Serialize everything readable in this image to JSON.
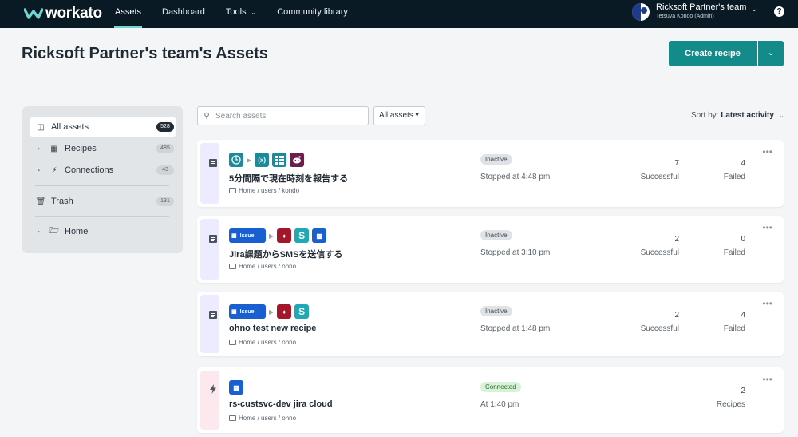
{
  "nav": {
    "logo_text": "workato",
    "items": [
      {
        "label": "Assets"
      },
      {
        "label": "Dashboard"
      },
      {
        "label": "Tools"
      },
      {
        "label": "Community library"
      }
    ],
    "team_name": "Ricksoft Partner's team",
    "team_user": "Tetsuya Kondo (Admin)",
    "help": "?"
  },
  "header": {
    "title": "Ricksoft Partner's team's Assets",
    "create_label": "Create recipe"
  },
  "sidebar": {
    "items": [
      {
        "label": "All assets",
        "count": "528"
      },
      {
        "label": "Recipes",
        "count": "485"
      },
      {
        "label": "Connections",
        "count": "43"
      },
      {
        "label": "Trash",
        "count": "131"
      },
      {
        "label": "Home"
      }
    ]
  },
  "toolbar": {
    "search_placeholder": "Search assets",
    "filter_label": "All assets",
    "sort_prefix": "Sort by:",
    "sort_value": "Latest activity"
  },
  "cards": [
    {
      "title": "5分間隔で現在時刻を報告する",
      "path": "Home / users / kondo",
      "badge": "Inactive",
      "status": "Stopped at 4:48 pm",
      "stat1_value": "7",
      "stat1_label": "Successful",
      "stat2_value": "4",
      "stat2_label": "Failed"
    },
    {
      "title": "Jira課題からSMSを送信する",
      "path": "Home / users / ohno",
      "badge": "Inactive",
      "status": "Stopped at 3:10 pm",
      "app_label": "Issue",
      "stat1_value": "2",
      "stat1_label": "Successful",
      "stat2_value": "0",
      "stat2_label": "Failed"
    },
    {
      "title": "ohno test new recipe",
      "path": "Home / users / ohno",
      "badge": "Inactive",
      "status": "Stopped at 1:48 pm",
      "app_label": "Issue",
      "stat1_value": "2",
      "stat1_label": "Successful",
      "stat2_value": "4",
      "stat2_label": "Failed"
    },
    {
      "title": "rs-custsvc-dev jira cloud",
      "path": "Home / users / ohno",
      "badge": "Connected",
      "status": "At 1:40 pm",
      "stat2_value": "2",
      "stat2_label": "Recipes"
    }
  ],
  "icons": {
    "recipe": "recipe-doc-icon",
    "connection": "lightning-icon",
    "clock": "clock-icon",
    "variable": "variable-icon",
    "list": "list-icon",
    "reddit": "reddit-icon",
    "jira": "jira-icon",
    "ruby": "ruby-icon",
    "sms": "sms-s-icon"
  },
  "colors": {
    "nav_bg": "#0a1a24",
    "accent": "#138b8b",
    "teal_app": "#1c8a9a",
    "jira_blue": "#1a5fd0",
    "ruby_red": "#a3172b",
    "sms_teal": "#1fa9b5",
    "reddit": "#6a1f4d"
  }
}
